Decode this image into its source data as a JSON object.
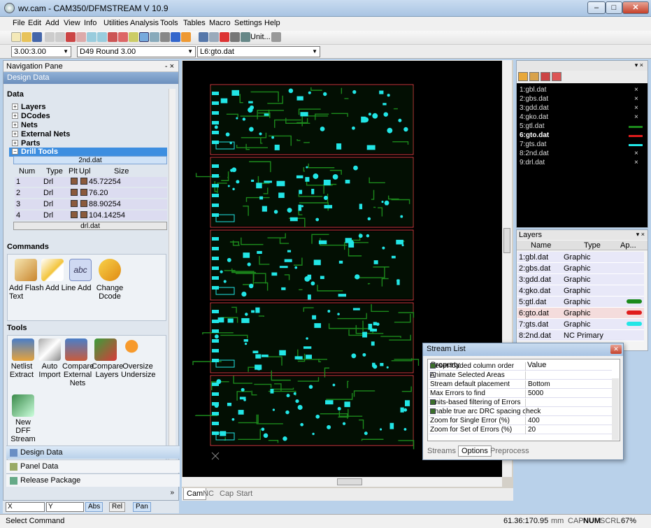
{
  "window": {
    "title": "wv.cam - CAM350/DFMSTREAM V 10.9"
  },
  "menu": [
    "File",
    "Edit",
    "Add",
    "View",
    "Info",
    "Utilities",
    "Analysis",
    "Tools",
    "Tables",
    "Macro",
    "Settings",
    "Help"
  ],
  "toolbar": {
    "unit_label": "Unit..."
  },
  "combos": {
    "zoom": "3.00:3.00",
    "dcode": "D49   Round 3.00",
    "layer": "L6:gto.dat"
  },
  "nav": {
    "title": "Navigation Pane",
    "header": "Design Data",
    "data_title": "Data",
    "tree": [
      "Layers",
      "DCodes",
      "Nets",
      "External Nets",
      "Parts",
      "Drill Tools"
    ],
    "drill_file": "2nd.dat",
    "drill_cols": [
      "Num",
      "Type",
      "Plt",
      "Upl",
      "Size"
    ],
    "drill_rows": [
      {
        "num": "1",
        "type": "Drl",
        "size": "45.72254"
      },
      {
        "num": "2",
        "type": "Drl",
        "size": "76.20"
      },
      {
        "num": "3",
        "type": "Drl",
        "size": "88.90254"
      },
      {
        "num": "4",
        "type": "Drl",
        "size": "104.14254"
      }
    ],
    "drill_file2": "drl.dat",
    "commands_title": "Commands",
    "commands": [
      "Add Flash",
      "Add Line",
      "Add Text",
      "Change",
      "Dcode"
    ],
    "tools_title": "Tools",
    "tools": [
      {
        "l1": "Netlist",
        "l2": "Extract"
      },
      {
        "l1": "Auto",
        "l2": "Import"
      },
      {
        "l1": "Compare",
        "l2": "External",
        "l3": "Nets"
      },
      {
        "l1": "Compare",
        "l2": "Layers"
      },
      {
        "l1": "Oversize",
        "l2": "Undersize"
      },
      {
        "l1": "New DFF",
        "l2": "Stream"
      }
    ],
    "bottom_tabs": [
      "Design Data",
      "Panel Data",
      "Release Package"
    ]
  },
  "coords": {
    "x_label": "X",
    "y_label": "Y",
    "abs": "Abs",
    "rel": "Rel",
    "pan": "Pan"
  },
  "canvas_tabs": [
    "Cam",
    "NC",
    "Cap",
    "Start"
  ],
  "layer_list": [
    {
      "name": "1:gbl.dat"
    },
    {
      "name": "2:gbs.dat"
    },
    {
      "name": "3:gdd.dat"
    },
    {
      "name": "4:gko.dat"
    },
    {
      "name": "5:gtl.dat"
    },
    {
      "name": "6:gto.dat"
    },
    {
      "name": "7:gts.dat"
    },
    {
      "name": "8:2nd.dat"
    },
    {
      "name": "9:drl.dat"
    }
  ],
  "layers_panel": {
    "title": "Layers",
    "cols": [
      "Name",
      "Type",
      "Ap..."
    ],
    "rows": [
      {
        "name": "1:gbl.dat",
        "type": "Graphic"
      },
      {
        "name": "2:gbs.dat",
        "type": "Graphic"
      },
      {
        "name": "3:gdd.dat",
        "type": "Graphic"
      },
      {
        "name": "4:gko.dat",
        "type": "Graphic"
      },
      {
        "name": "5:gtl.dat",
        "type": "Graphic"
      },
      {
        "name": "6:gto.dat",
        "type": "Graphic"
      },
      {
        "name": "7:gts.dat",
        "type": "Graphic"
      },
      {
        "name": "8:2nd.dat",
        "type": "NC Primary"
      }
    ]
  },
  "stream_list": {
    "title": "Stream List",
    "cols": [
      "Property",
      "Value"
    ],
    "rows": [
      {
        "prop": "Reset loaded column order",
        "val": "",
        "chk": "on"
      },
      {
        "prop": "Animate Selected Areas",
        "val": "",
        "chk": "off"
      },
      {
        "prop": "Stream default placement",
        "val": "Bottom",
        "chk": ""
      },
      {
        "prop": "Max Errors to find",
        "val": "5000",
        "chk": ""
      },
      {
        "prop": "Units-based filtering of Errors",
        "val": "",
        "chk": "on"
      },
      {
        "prop": "Enable true arc DRC spacing check",
        "val": "",
        "chk": "on"
      },
      {
        "prop": "Zoom for Single Error (%)",
        "val": "400",
        "chk": ""
      },
      {
        "prop": "Zoom for Set of Errors (%)",
        "val": "20",
        "chk": ""
      }
    ],
    "tabs": [
      "Streams",
      "Options",
      "Preprocess"
    ]
  },
  "status": {
    "left": "Select Command",
    "coords": "61.36:170.95",
    "unit": "mm",
    "cap": "CAP",
    "num": "NUM",
    "scrl": "SCRL",
    "zoom": "67%"
  },
  "colors": {
    "pcb_bg": "#000000",
    "trace": "#1c8a1c",
    "pad": "#22e6e6",
    "board_outline": "#c83c3c"
  }
}
